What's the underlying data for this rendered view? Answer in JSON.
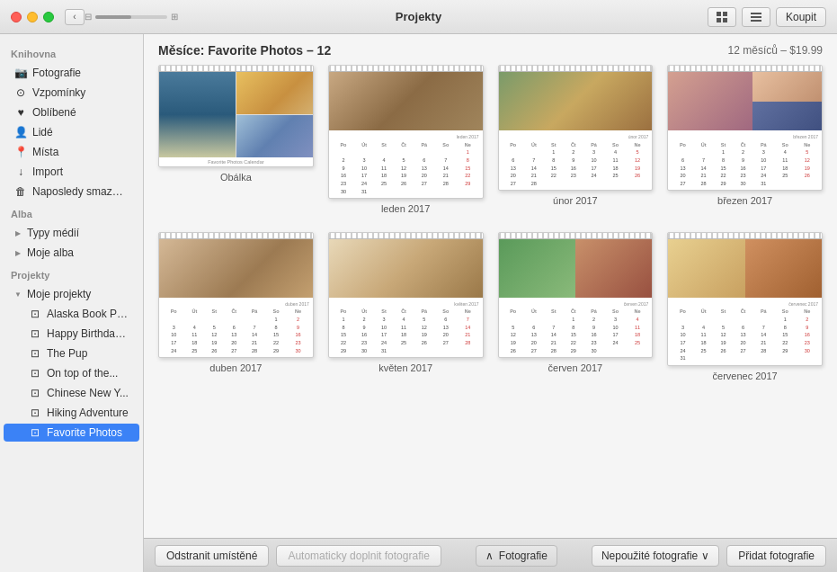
{
  "titleBar": {
    "title": "Projekty",
    "buyLabel": "Koupit"
  },
  "sidebar": {
    "sections": [
      {
        "header": "Knihovna",
        "items": [
          {
            "id": "fotografie",
            "label": "Fotografie",
            "icon": "📷",
            "level": 0
          },
          {
            "id": "vzpominky",
            "label": "Vzpomínky",
            "icon": "⊙",
            "level": 0
          },
          {
            "id": "oblibene",
            "label": "Oblíbené",
            "icon": "♥",
            "level": 0
          },
          {
            "id": "lide",
            "label": "Lidé",
            "icon": "👤",
            "level": 0
          },
          {
            "id": "mista",
            "label": "Místa",
            "icon": "📍",
            "level": 0
          },
          {
            "id": "import",
            "label": "Import",
            "icon": "↓",
            "level": 0
          },
          {
            "id": "naposledy",
            "label": "Naposledy smazáno",
            "icon": "🗑",
            "level": 0
          }
        ]
      },
      {
        "header": "Alba",
        "items": [
          {
            "id": "typy-medii",
            "label": "Typy médií",
            "icon": "▶",
            "level": 0
          },
          {
            "id": "moje-alba",
            "label": "Moje alba",
            "icon": "▶",
            "level": 0
          }
        ]
      },
      {
        "header": "Projekty",
        "items": [
          {
            "id": "moje-projekty",
            "label": "Moje projekty",
            "icon": "▼",
            "level": 0
          },
          {
            "id": "alaska",
            "label": "Alaska Book Pr...",
            "icon": "□",
            "level": 1
          },
          {
            "id": "birthday",
            "label": "Happy Birthday...",
            "icon": "□",
            "level": 1
          },
          {
            "id": "pup",
            "label": "The Pup",
            "icon": "□",
            "level": 1
          },
          {
            "id": "ontop",
            "label": "On top of the...",
            "icon": "□",
            "level": 1
          },
          {
            "id": "chinese",
            "label": "Chinese New Y...",
            "icon": "□",
            "level": 1
          },
          {
            "id": "hiking",
            "label": "Hiking Adventure",
            "icon": "□",
            "level": 1
          },
          {
            "id": "favorite",
            "label": "Favorite Photos",
            "icon": "□",
            "level": 1,
            "active": true
          }
        ]
      }
    ]
  },
  "content": {
    "headerTitle": "Měsíce: Favorite Photos – 12",
    "headerInfo": "12 měsíců – $19.99",
    "months": [
      {
        "id": "cover",
        "label": "Obálka",
        "type": "cover"
      },
      {
        "id": "jan2017",
        "label": "leden 2017",
        "type": "calendar",
        "photoType": "photo-dog1",
        "weeks": [
          [
            "Po",
            "Út",
            "St",
            "Čt",
            "Pá",
            "So",
            "Ne"
          ],
          [
            "",
            "",
            "",
            "",
            "",
            "",
            "1"
          ],
          [
            "2",
            "3",
            "4",
            "5",
            "6",
            "7",
            "8"
          ],
          [
            "9",
            "10",
            "11",
            "12",
            "13",
            "14",
            "15"
          ],
          [
            "16",
            "17",
            "18",
            "19",
            "20",
            "21",
            "22"
          ],
          [
            "23",
            "24",
            "25",
            "26",
            "27",
            "28",
            "29"
          ],
          [
            "30",
            "31",
            "",
            "",
            "",
            "",
            ""
          ]
        ],
        "monthLabel": "leden 2017"
      },
      {
        "id": "feb2017",
        "label": "únor 2017",
        "type": "calendar",
        "photoType": "photo-dog3",
        "weeks": [
          [
            "Po",
            "Út",
            "St",
            "Čt",
            "Pá",
            "So",
            "Ne"
          ],
          [
            "",
            "",
            "1",
            "2",
            "3",
            "4",
            "5"
          ],
          [
            "6",
            "7",
            "8",
            "9",
            "10",
            "11",
            "12"
          ],
          [
            "13",
            "14",
            "15",
            "16",
            "17",
            "18",
            "19"
          ],
          [
            "20",
            "21",
            "22",
            "23",
            "24",
            "25",
            "26"
          ],
          [
            "27",
            "28",
            "",
            "",
            "",
            "",
            ""
          ]
        ],
        "monthLabel": "únor 2017"
      },
      {
        "id": "mar2017",
        "label": "březen 2017",
        "type": "calendar",
        "photoType": "photo-person1",
        "weeks": [
          [
            "Po",
            "Út",
            "St",
            "Čt",
            "Pá",
            "So",
            "Ne"
          ],
          [
            "",
            "",
            "1",
            "2",
            "3",
            "4",
            "5"
          ],
          [
            "6",
            "7",
            "8",
            "9",
            "10",
            "11",
            "12"
          ],
          [
            "13",
            "14",
            "15",
            "16",
            "17",
            "18",
            "19"
          ],
          [
            "20",
            "21",
            "22",
            "23",
            "24",
            "25",
            "26"
          ],
          [
            "27",
            "28",
            "29",
            "30",
            "31",
            "",
            ""
          ]
        ],
        "monthLabel": "březen 2017"
      },
      {
        "id": "apr2017",
        "label": "duben 2017",
        "type": "calendar",
        "photoType": "photo-dog2",
        "weeks": [
          [
            "Po",
            "Út",
            "St",
            "Čt",
            "Pá",
            "So",
            "Ne"
          ],
          [
            "",
            "",
            "",
            "",
            "",
            "1",
            "2"
          ],
          [
            "3",
            "4",
            "5",
            "6",
            "7",
            "8",
            "9"
          ],
          [
            "10",
            "11",
            "12",
            "13",
            "14",
            "15",
            "16"
          ],
          [
            "17",
            "18",
            "19",
            "20",
            "21",
            "22",
            "23"
          ],
          [
            "24",
            "25",
            "26",
            "27",
            "28",
            "29",
            "30"
          ]
        ],
        "monthLabel": "duben 2017"
      },
      {
        "id": "may2017",
        "label": "květen 2017",
        "type": "calendar",
        "photoType": "photo-hat",
        "weeks": [
          [
            "Po",
            "Út",
            "St",
            "Čt",
            "Pá",
            "So",
            "Ne"
          ],
          [
            "1",
            "2",
            "3",
            "4",
            "5",
            "6",
            "7"
          ],
          [
            "8",
            "9",
            "10",
            "11",
            "12",
            "13",
            "14"
          ],
          [
            "15",
            "16",
            "17",
            "18",
            "19",
            "20",
            "21"
          ],
          [
            "22",
            "23",
            "24",
            "25",
            "26",
            "27",
            "28"
          ],
          [
            "29",
            "30",
            "31",
            "",
            "",
            "",
            ""
          ]
        ],
        "monthLabel": "květen 2017"
      },
      {
        "id": "jun2017",
        "label": "červen 2017",
        "type": "calendar",
        "photoType": "photo-kids",
        "weeks": [
          [
            "Po",
            "Út",
            "St",
            "Čt",
            "Pá",
            "So",
            "Ne"
          ],
          [
            "",
            "",
            "",
            "1",
            "2",
            "3",
            "4"
          ],
          [
            "5",
            "6",
            "7",
            "8",
            "9",
            "10",
            "11"
          ],
          [
            "12",
            "13",
            "14",
            "15",
            "16",
            "17",
            "18"
          ],
          [
            "19",
            "20",
            "21",
            "22",
            "23",
            "24",
            "25"
          ],
          [
            "26",
            "27",
            "28",
            "29",
            "30",
            "",
            ""
          ]
        ],
        "monthLabel": "červen 2017"
      },
      {
        "id": "jul2017",
        "label": "červenec 2017",
        "type": "calendar",
        "photoType": "photo-outdoor",
        "weeks": [
          [
            "Po",
            "Út",
            "St",
            "Čt",
            "Pá",
            "So",
            "Ne"
          ],
          [
            "",
            "",
            "",
            "",
            "",
            "1",
            "2"
          ],
          [
            "3",
            "4",
            "5",
            "6",
            "7",
            "8",
            "9"
          ],
          [
            "10",
            "11",
            "12",
            "13",
            "14",
            "15",
            "16"
          ],
          [
            "17",
            "18",
            "19",
            "20",
            "21",
            "22",
            "23"
          ],
          [
            "24",
            "25",
            "26",
            "27",
            "28",
            "29",
            "30"
          ],
          [
            "31",
            "",
            "",
            "",
            "",
            "",
            ""
          ]
        ],
        "monthLabel": "červenec 2017"
      }
    ]
  },
  "toolbar": {
    "removeLabel": "Odstranit umístěné",
    "autoFillLabel": "Automaticky doplnit fotografie",
    "photosLabel": "Fotografie",
    "unusedLabel": "Nepoužité fotografie",
    "addLabel": "Přidat fotografie"
  }
}
